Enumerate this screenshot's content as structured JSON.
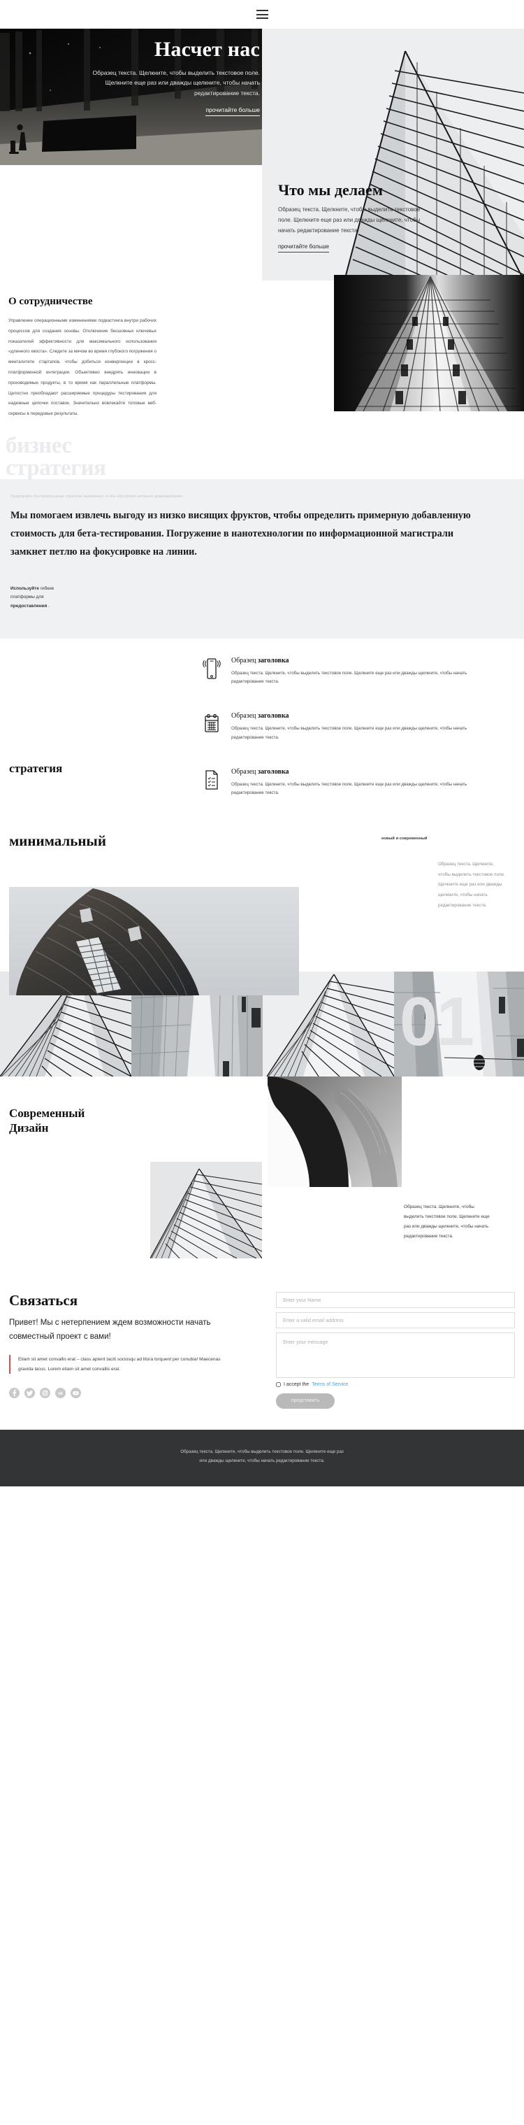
{
  "header": {
    "menu_icon": "hamburger-icon"
  },
  "hero": {
    "title": "Насчет нас",
    "text": "Образец текста. Щелкните, чтобы выделить текстовое поле. Щелкните еще раз или дважды щелкните, чтобы начать редактирование текста.",
    "link": "прочитайте больше"
  },
  "what_we_do": {
    "title": "Что мы делаем",
    "text": "Образец текста. Щелкните, чтобы выделить текстовое поле. Щелкните еще раз или дважды щелкните, чтобы начать редактирование текста.",
    "link": "прочитайте больше"
  },
  "about": {
    "title": "О сотрудничестве",
    "text": "Управление операционными изменениями подкастинга внутри рабочих процессов для создания основы. Отключение бесшовных ключевых показателей эффективности для максимального использования «длинного хвоста». Следите за мячом во время глубокого погружения о менталитете стартапов, чтобы добиться конвергенции в кросс-платформенной интеграции. Объективно внедрять инновации в производимые продукты, в то время как параллельные платформы. Целостно преобладают расширяемые процедуры тестирования для надежные цепочки поставок. Значительно вовлекайте топовые веб-сервисы в передовые результаты.",
    "watermark_line1": "бизнес",
    "watermark_line2": "стратегия"
  },
  "statement": {
    "kicker": "Предлагайте беспроигрышные стратегии выживания, чтобы обеспечить активное доминирование.",
    "big": "Мы помогаем извлечь выгоду из низко висящих фруктов, чтобы определить примерную добавленную стоимость для бета-тестирования. Погружение в нанотехнологии по информационной магистрали замкнет петлю на фокусировке на линии.",
    "small_bold_1": "Используйте",
    "small_plain_1": " гибкие платформы для ",
    "small_bold_2": "предоставления",
    "small_plain_2": " ."
  },
  "strategy": {
    "heading": "стратегия",
    "features": [
      {
        "icon": "mobile-phone-icon",
        "title_normal": "Образец ",
        "title_bold": "заголовка",
        "text": "Образец текста. Щелкните, чтобы выделить текстовое поле. Щелкните еще раз или дважды щелкните, чтобы начать редактирование текста."
      },
      {
        "icon": "calendar-icon",
        "title_normal": "Образец ",
        "title_bold": "заголовка",
        "text": "Образец текста. Щелкните, чтобы выделить текстовое поле. Щелкните еще раз или дважды щелкните, чтобы начать редактирование текста."
      },
      {
        "icon": "checklist-document-icon",
        "title_normal": "Образец ",
        "title_bold": "заголовка",
        "text": "Образец текста. Щелкните, чтобы выделить текстовое поле. Щелкните еще раз или дважды щелкните, чтобы начать редактирование текста."
      }
    ]
  },
  "minimal": {
    "heading": "минимальный",
    "kicker": "новый и современный",
    "text": "Образец текста. Щелкните, чтобы выделить текстовое поле. Щелкните еще раз или дважды щелкните, чтобы начать редактирование текста.",
    "number": "01"
  },
  "modern": {
    "title_line1": "Современный",
    "title_line2": "Дизайн",
    "text": "Образец текста. Щелкните, чтобы выделить текстовое поле. Щелкните еще раз или дважды щелкните, чтобы начать редактирование текста."
  },
  "contact": {
    "title": "Связаться",
    "lead_line1": "Привет! Мы с нетерпением ждем возможности начать",
    "lead_line2": "совместный проект с вами!",
    "quote": "Etiam sit amet convallis erat – class aptent taciti sociosqu ad litora torquent per conubia! Maecenas gravida lacus. Lorem etiam sit amet convallis erat.",
    "socials": [
      "facebook-icon",
      "twitter-icon",
      "instagram-icon",
      "vk-icon",
      "youtube-icon"
    ],
    "form": {
      "name_placeholder": "Enter your Name",
      "name_value": "",
      "email_placeholder": "Enter a valid email address",
      "email_value": "",
      "message_placeholder": "Enter your message",
      "message_value": "",
      "accept_label": "I accept the",
      "terms_link": "Terms of Service",
      "submit_label": "представить"
    }
  },
  "footer": {
    "text": "Образец текста. Щелкните, чтобы выделить текстовое поле. Щелкните еще раз или дважды щелкните, чтобы начать редактирование текста."
  },
  "colors": {
    "accent_red": "#e04a4a",
    "link_blue": "#5b9bc4",
    "band_gray": "#f0f1f3",
    "footer_dark": "#333436"
  }
}
